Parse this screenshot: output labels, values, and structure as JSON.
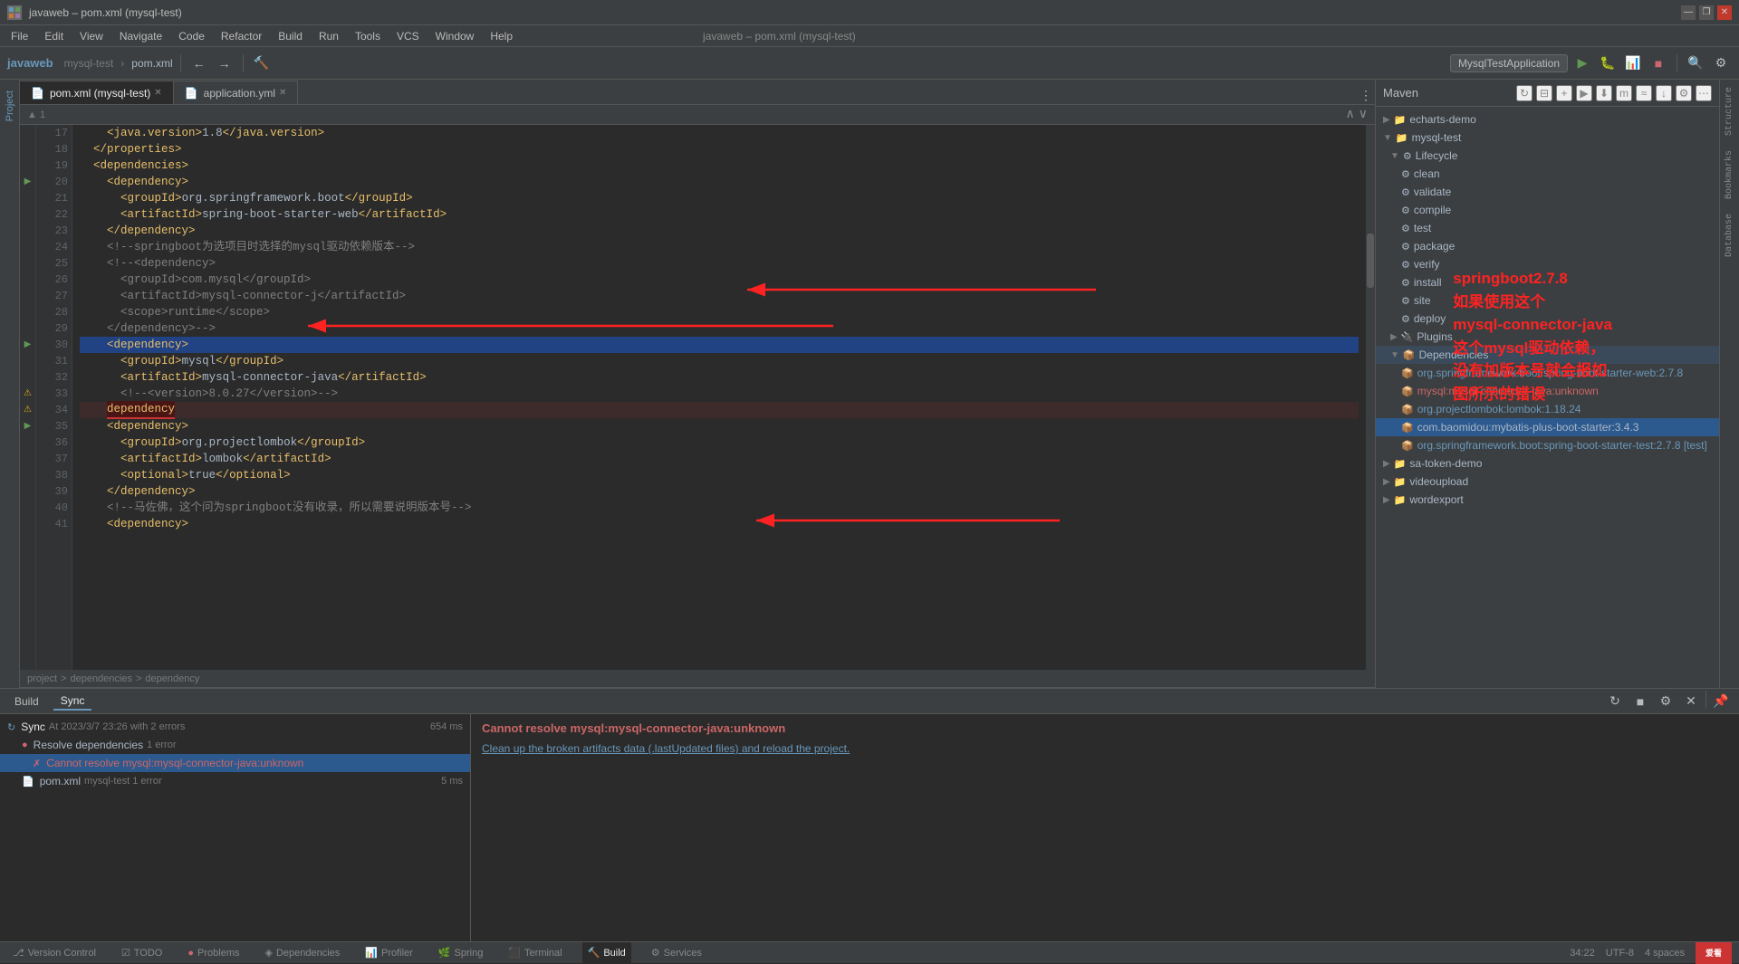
{
  "titleBar": {
    "title": "javaweb – pom.xml (mysql-test)",
    "controls": [
      "—",
      "❐",
      "✕"
    ]
  },
  "menuBar": {
    "items": [
      "File",
      "Edit",
      "View",
      "Navigate",
      "Code",
      "Refactor",
      "Build",
      "Run",
      "Tools",
      "VCS",
      "Window",
      "Help"
    ]
  },
  "toolbar": {
    "projectName": "javaweb",
    "moduleName": "mysql-test",
    "fileName": "pom.xml",
    "runConfig": "MysqlTestApplication"
  },
  "tabs": [
    {
      "label": "pom.xml (mysql-test)",
      "active": true,
      "modified": false
    },
    {
      "label": "application.yml",
      "active": false,
      "modified": false
    }
  ],
  "breadcrumb": [
    "project",
    "dependencies",
    "dependency"
  ],
  "editor": {
    "lines": [
      {
        "num": 17,
        "code": "    <java.version>1.8</java.version>",
        "type": "normal"
      },
      {
        "num": 18,
        "code": "  </properties>",
        "type": "normal"
      },
      {
        "num": 19,
        "code": "  <dependencies>",
        "type": "normal"
      },
      {
        "num": 20,
        "code": "    <dependency>",
        "type": "normal",
        "gutter": "run"
      },
      {
        "num": 21,
        "code": "      <groupId>org.springframework.boot</groupId>",
        "type": "normal"
      },
      {
        "num": 22,
        "code": "      <artifactId>spring-boot-starter-web</artifactId>",
        "type": "normal"
      },
      {
        "num": 23,
        "code": "    </dependency>",
        "type": "normal"
      },
      {
        "num": 24,
        "code": "    <!--springboot为选项目时选择的mysql驱动依赖版本-->",
        "type": "normal"
      },
      {
        "num": 25,
        "code": "    <!--<dependency>",
        "type": "normal"
      },
      {
        "num": 26,
        "code": "      <groupId>com.mysql</groupId>",
        "type": "normal"
      },
      {
        "num": 27,
        "code": "      <artifactId>mysql-connector-j</artifactId>",
        "type": "normal"
      },
      {
        "num": 28,
        "code": "      <scope>runtime</scope>",
        "type": "normal"
      },
      {
        "num": 29,
        "code": "    </dependency>-->",
        "type": "normal"
      },
      {
        "num": 30,
        "code": "    <dependency>",
        "type": "highlighted",
        "gutter": "run"
      },
      {
        "num": 31,
        "code": "      <groupId>mysql</groupId>",
        "type": "normal"
      },
      {
        "num": 32,
        "code": "      <artifactId>mysql-connector-java</artifactId>",
        "type": "normal"
      },
      {
        "num": 33,
        "code": "      <!--<version>8.0.27</version>-->",
        "type": "normal",
        "gutter": "warn"
      },
      {
        "num": 34,
        "code": "    <dependency>",
        "type": "error",
        "gutter": "warn"
      },
      {
        "num": 35,
        "code": "    <dependency>",
        "type": "normal",
        "gutter": "run"
      },
      {
        "num": 36,
        "code": "      <groupId>org.projectlombok</groupId>",
        "type": "normal"
      },
      {
        "num": 37,
        "code": "      <artifactId>lombok</artifactId>",
        "type": "normal"
      },
      {
        "num": 38,
        "code": "      <optional>true</optional>",
        "type": "normal"
      },
      {
        "num": 39,
        "code": "    </dependency>",
        "type": "normal"
      },
      {
        "num": 40,
        "code": "    <!--马佐佛，这个问为springboot没有收录，所以需要说明版本号-->",
        "type": "normal"
      },
      {
        "num": 41,
        "code": "    <dependency>",
        "type": "normal"
      }
    ]
  },
  "maven": {
    "title": "Maven",
    "tree": [
      {
        "level": 0,
        "label": "echarts-demo",
        "type": "folder",
        "expanded": false
      },
      {
        "level": 0,
        "label": "mysql-test",
        "type": "folder",
        "expanded": true
      },
      {
        "level": 1,
        "label": "Lifecycle",
        "type": "folder",
        "expanded": true
      },
      {
        "level": 2,
        "label": "clean",
        "type": "lifecycle"
      },
      {
        "level": 2,
        "label": "validate",
        "type": "lifecycle"
      },
      {
        "level": 2,
        "label": "compile",
        "type": "lifecycle"
      },
      {
        "level": 2,
        "label": "test",
        "type": "lifecycle"
      },
      {
        "level": 2,
        "label": "package",
        "type": "lifecycle"
      },
      {
        "level": 2,
        "label": "verify",
        "type": "lifecycle"
      },
      {
        "level": 2,
        "label": "install",
        "type": "lifecycle"
      },
      {
        "level": 2,
        "label": "site",
        "type": "lifecycle"
      },
      {
        "level": 2,
        "label": "deploy",
        "type": "lifecycle"
      },
      {
        "level": 1,
        "label": "Plugins",
        "type": "folder",
        "expanded": false
      },
      {
        "level": 1,
        "label": "Dependencies",
        "type": "folder",
        "expanded": true,
        "selected": true
      },
      {
        "level": 2,
        "label": "org.springframework.boot:spring-boot-starter-web:2.7.8",
        "type": "dep"
      },
      {
        "level": 2,
        "label": "mysql:mysql-connector-java:unknown",
        "type": "dep",
        "error": true
      },
      {
        "level": 2,
        "label": "org.projectlombok:lombok:1.18.24",
        "type": "dep"
      },
      {
        "level": 2,
        "label": "com.baomidou:mybatis-plus-boot-starter:3.4.3",
        "type": "dep",
        "selected": true
      },
      {
        "level": 2,
        "label": "org.springframework.boot:spring-boot-starter-test:2.7.8 [test]",
        "type": "dep"
      },
      {
        "level": 0,
        "label": "sa-token-demo",
        "type": "folder",
        "expanded": false
      },
      {
        "level": 0,
        "label": "videoupload",
        "type": "folder",
        "expanded": false
      },
      {
        "level": 0,
        "label": "wordexport",
        "type": "folder",
        "expanded": false
      }
    ]
  },
  "build": {
    "tabs": [
      "Build",
      "Sync"
    ],
    "activeTab": "Sync",
    "rows": [
      {
        "label": "Sync  At 2023/3/7 23:26 with 2 errors",
        "time": "654 ms",
        "type": "sync",
        "expanded": true
      },
      {
        "label": "Resolve dependencies  1 error",
        "time": "",
        "type": "error",
        "indent": 1,
        "expanded": true
      },
      {
        "label": "Cannot resolve mysql:mysql-connector-java:unknown",
        "time": "",
        "type": "error-item",
        "indent": 2,
        "selected": true
      },
      {
        "label": "pom.xml  mysql-test 1 error",
        "time": "5 ms",
        "type": "error",
        "indent": 1
      }
    ],
    "errorMessage": "Cannot resolve mysql:mysql-connector-java:unknown",
    "fixMessage": "Clean up the broken artifacts data (.lastUpdated files) and reload the project."
  },
  "statusBar": {
    "tabs": [
      "Version Control",
      "TODO",
      "Problems",
      "Dependencies",
      "Profiler",
      "Spring",
      "Terminal",
      "Build",
      "Services"
    ],
    "activeTab": "Build",
    "time": "34:22",
    "problemCount": 1
  },
  "annotation": {
    "text": "springboot2.7.8\n如果使用这个\nmysql-connector-java\n这个mysql驱动依赖，\n没有加版本号就会报如\n图所示的错误",
    "lines": [
      "springboot2.7.8",
      "如果使用这个",
      "mysql-connector-java",
      "这个mysql驱动依赖，",
      "没有加版本号就会报如",
      "图所示的错误"
    ]
  }
}
